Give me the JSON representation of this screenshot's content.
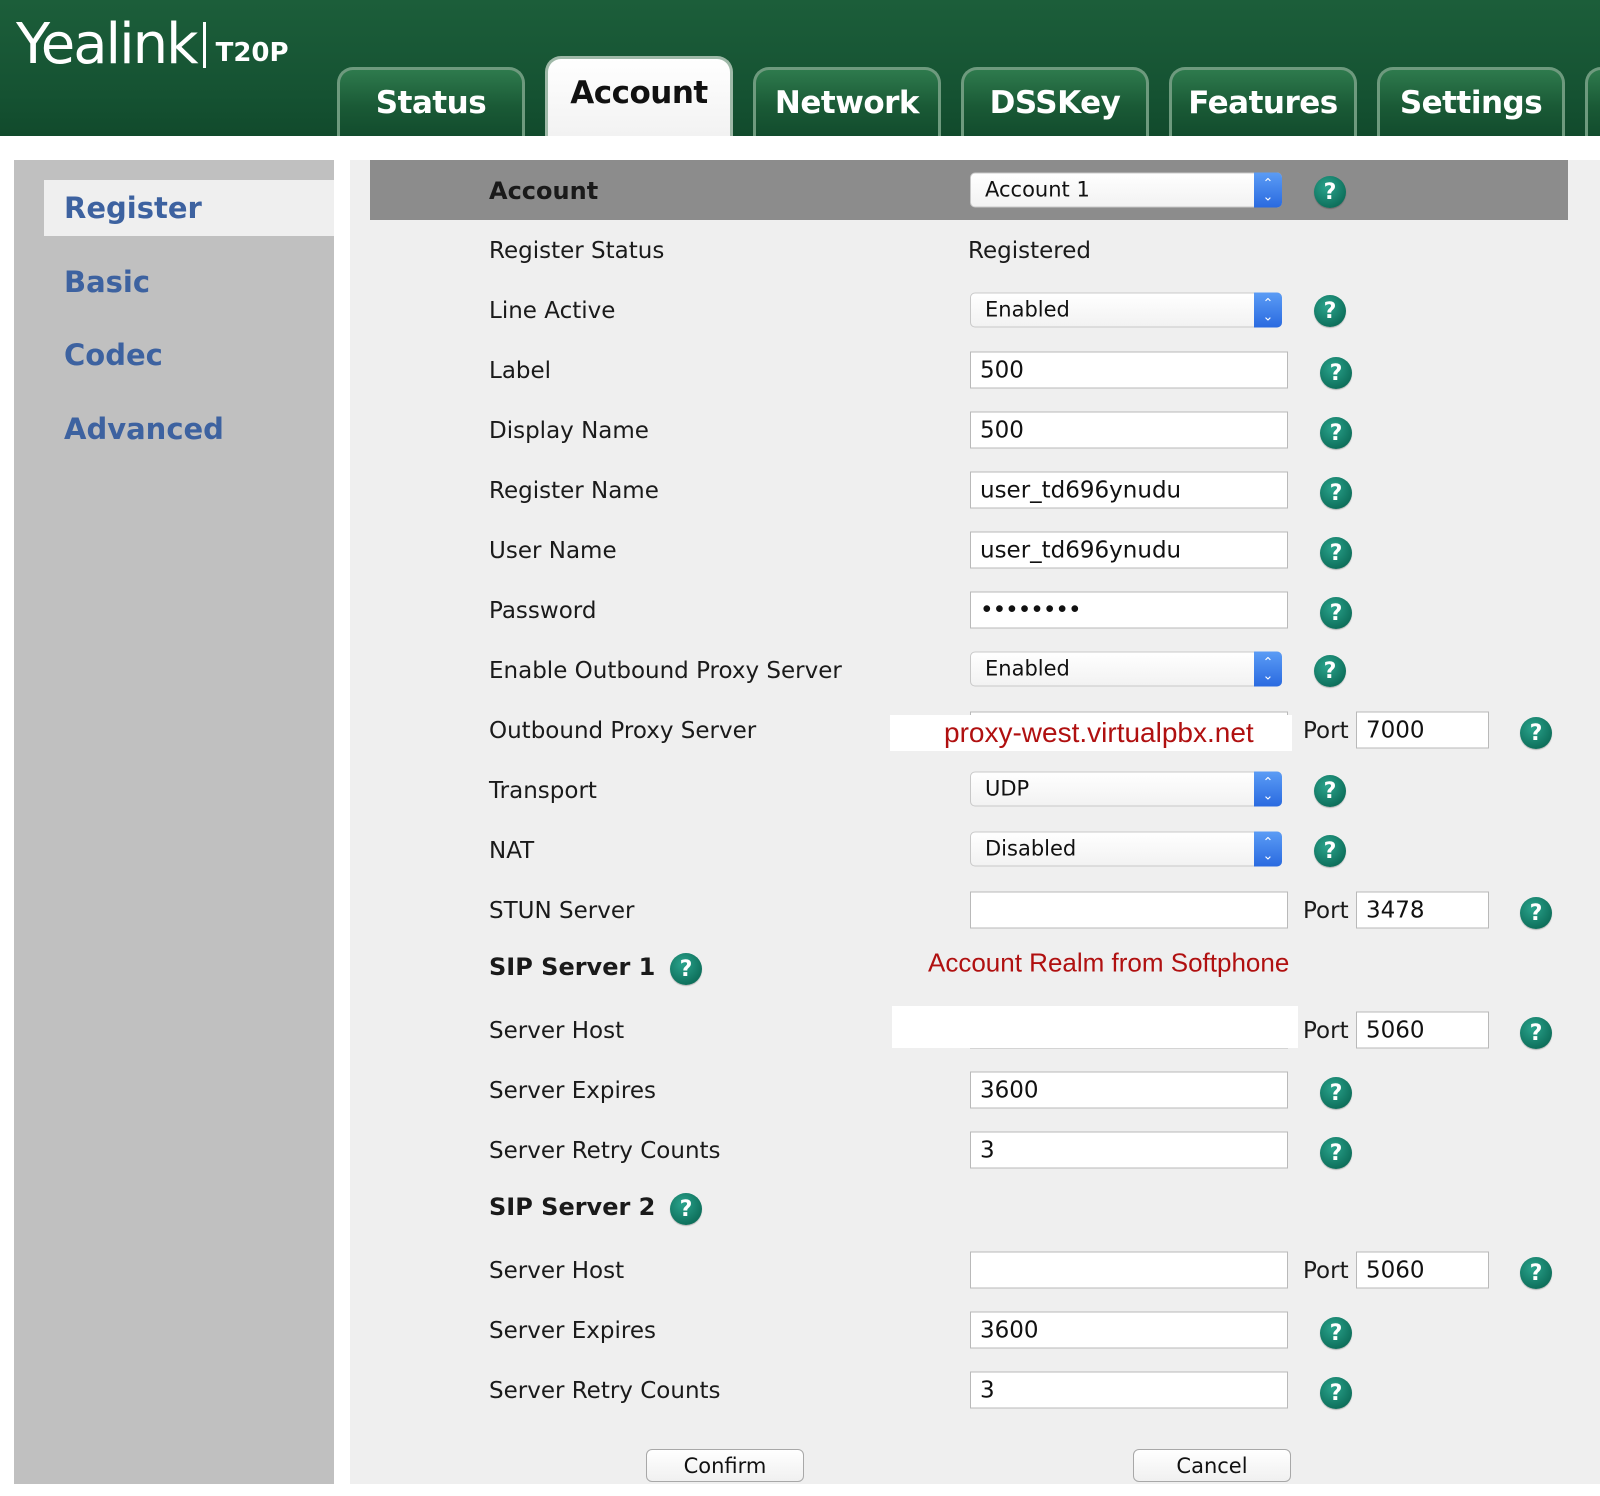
{
  "header": {
    "brand": "Yealink",
    "model": "T20P",
    "tabs": [
      {
        "label": "Status"
      },
      {
        "label": "Account"
      },
      {
        "label": "Network"
      },
      {
        "label": "DSSKey"
      },
      {
        "label": "Features"
      },
      {
        "label": "Settings"
      }
    ],
    "active_tab": "Account"
  },
  "sidebar": {
    "items": [
      {
        "label": "Register"
      },
      {
        "label": "Basic"
      },
      {
        "label": "Codec"
      },
      {
        "label": "Advanced"
      }
    ],
    "active_item": "Register"
  },
  "form": {
    "account": {
      "label": "Account",
      "value": "Account 1"
    },
    "register_status": {
      "label": "Register Status",
      "value": "Registered"
    },
    "line_active": {
      "label": "Line Active",
      "value": "Enabled"
    },
    "label": {
      "label": "Label",
      "value": "500"
    },
    "display_name": {
      "label": "Display Name",
      "value": "500"
    },
    "register_name": {
      "label": "Register Name",
      "value": "user_td696ynudu"
    },
    "user_name": {
      "label": "User Name",
      "value": "user_td696ynudu"
    },
    "password": {
      "label": "Password",
      "value": "••••••••"
    },
    "enable_outbound_proxy": {
      "label": "Enable Outbound Proxy Server",
      "value": "Enabled"
    },
    "outbound_proxy": {
      "label": "Outbound Proxy Server",
      "value": "proxy-west.virtualpbx.net",
      "port_label": "Port",
      "port": "7000"
    },
    "transport": {
      "label": "Transport",
      "value": "UDP"
    },
    "nat": {
      "label": "NAT",
      "value": "Disabled"
    },
    "stun_server": {
      "label": "STUN Server",
      "value": "",
      "port_label": "Port",
      "port": "3478"
    },
    "sip_server_1": {
      "title": "SIP Server 1",
      "annotation": "Account Realm from Softphone",
      "server_host": {
        "label": "Server Host",
        "value": "",
        "port_label": "Port",
        "port": "5060"
      },
      "server_expires": {
        "label": "Server Expires",
        "value": "3600"
      },
      "server_retry_counts": {
        "label": "Server Retry Counts",
        "value": "3"
      }
    },
    "sip_server_2": {
      "title": "SIP Server 2",
      "server_host": {
        "label": "Server Host",
        "value": "",
        "port_label": "Port",
        "port": "5060"
      },
      "server_expires": {
        "label": "Server Expires",
        "value": "3600"
      },
      "server_retry_counts": {
        "label": "Server Retry Counts",
        "value": "3"
      }
    }
  },
  "buttons": {
    "confirm": "Confirm",
    "cancel": "Cancel"
  },
  "icons": {
    "help": "?",
    "select_arrows": "⌃⌄"
  },
  "colors": {
    "header_green": "#155232",
    "sidebar_link": "#3d62a0",
    "help_teal": "#0d6e5a",
    "annotation_red": "#b01010",
    "select_blue": "#2a6ae0"
  }
}
